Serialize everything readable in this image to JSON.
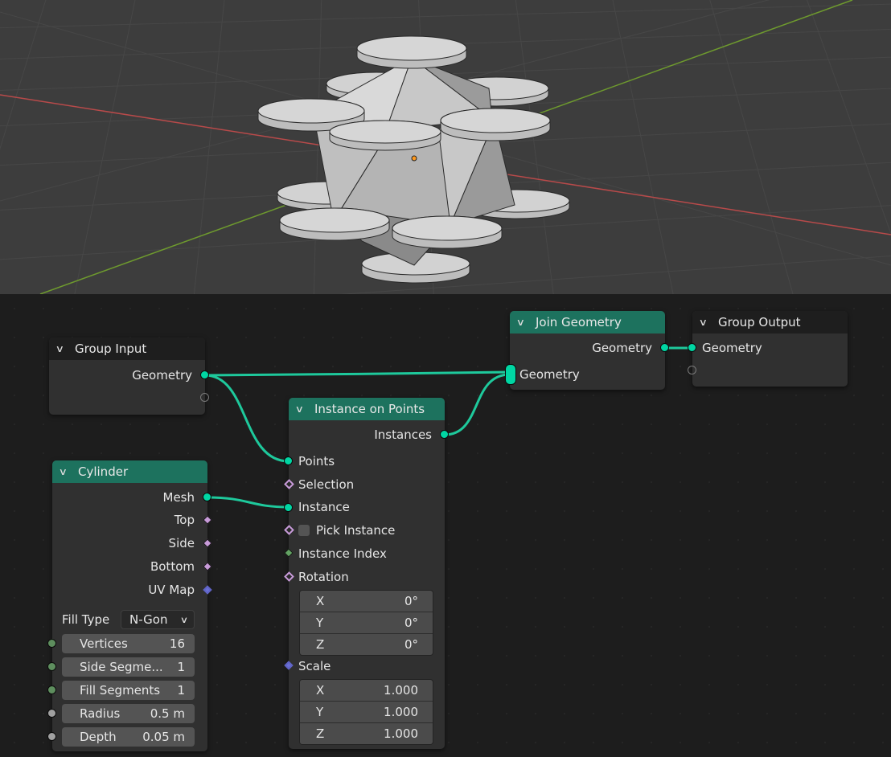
{
  "nodes": {
    "group_input": {
      "title": "Group Input",
      "outputs": [
        "Geometry"
      ]
    },
    "join_geometry": {
      "title": "Join Geometry",
      "outputs": [
        "Geometry"
      ],
      "inputs": [
        "Geometry"
      ]
    },
    "group_output": {
      "title": "Group Output",
      "inputs": [
        "Geometry"
      ]
    },
    "instance_on_points": {
      "title": "Instance on Points",
      "outputs": [
        "Instances"
      ],
      "inputs": {
        "points": "Points",
        "selection": "Selection",
        "instance": "Instance",
        "pick_instance": "Pick Instance",
        "instance_index": "Instance Index",
        "rotation": "Rotation",
        "scale": "Scale"
      },
      "rotation": [
        {
          "axis": "X",
          "value": "0°"
        },
        {
          "axis": "Y",
          "value": "0°"
        },
        {
          "axis": "Z",
          "value": "0°"
        }
      ],
      "scale": [
        {
          "axis": "X",
          "value": "1.000"
        },
        {
          "axis": "Y",
          "value": "1.000"
        },
        {
          "axis": "Z",
          "value": "1.000"
        }
      ]
    },
    "cylinder": {
      "title": "Cylinder",
      "outputs": [
        "Mesh",
        "Top",
        "Side",
        "Bottom",
        "UV Map"
      ],
      "fill_type": {
        "label": "Fill Type",
        "value": "N-Gon"
      },
      "fields": [
        {
          "label": "Vertices",
          "value": "16"
        },
        {
          "label": "Side Segme...",
          "value": "1"
        },
        {
          "label": "Fill Segments",
          "value": "1"
        },
        {
          "label": "Radius",
          "value": "0.5 m"
        },
        {
          "label": "Depth",
          "value": "0.05 m"
        }
      ]
    }
  },
  "colors": {
    "geometry_socket": "#00d6a3",
    "geometry_header": "#1d725e",
    "viewport_bg": "#3d3d3d",
    "x_axis": "#b84a4a",
    "y_axis": "#6e9a2e"
  },
  "icons": [
    "chevron-down-icon",
    "origin-dot-icon"
  ]
}
